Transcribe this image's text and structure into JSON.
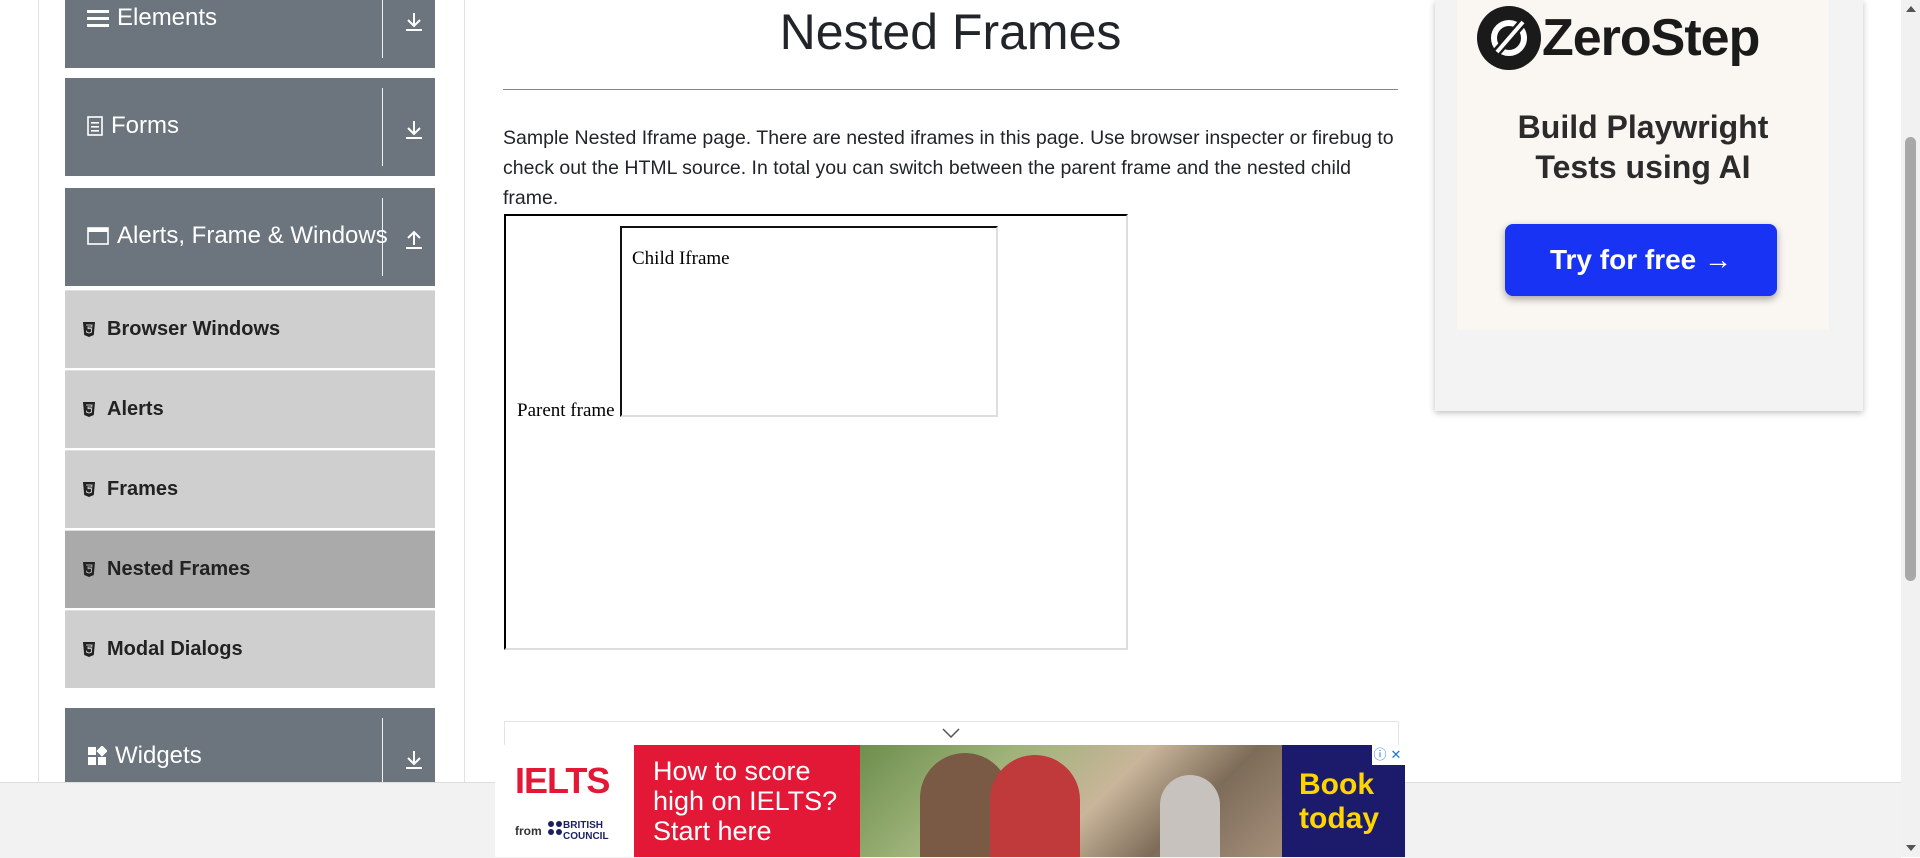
{
  "sidebar": {
    "groups": [
      {
        "label": "Elements",
        "icon": "menu-icon",
        "toggle": "download-icon"
      },
      {
        "label": "Forms",
        "icon": "document-icon",
        "toggle": "download-icon"
      },
      {
        "label": "Alerts, Frame & Windows",
        "icon": "window-icon",
        "toggle": "upload-icon"
      },
      {
        "label": "Widgets",
        "icon": "widgets-icon",
        "toggle": "download-icon"
      }
    ],
    "items": [
      {
        "label": "Browser Windows",
        "icon": "html5-icon"
      },
      {
        "label": "Alerts",
        "icon": "html5-icon"
      },
      {
        "label": "Frames",
        "icon": "html5-icon"
      },
      {
        "label": "Nested Frames",
        "icon": "html5-icon",
        "active": true
      },
      {
        "label": "Modal Dialogs",
        "icon": "html5-icon"
      }
    ]
  },
  "main": {
    "title": "Nested Frames",
    "description": "Sample Nested Iframe page. There are nested iframes in this page. Use browser inspecter or firebug to check out the HTML source. In total you can switch between the parent frame and the nested child frame.",
    "parent_frame_text": "Parent frame",
    "child_frame_text": "Child Iframe"
  },
  "side_ad": {
    "brand": "ZeroStep",
    "headline_line1": "Build Playwright",
    "headline_line2": "Tests using AI",
    "cta": "Try for free →"
  },
  "bottom_ad": {
    "logo": "IELTS",
    "from": "from",
    "council_line1": "BRITISH",
    "council_line2": "COUNCIL",
    "line1": "How to score",
    "line2": "high on IELTS?",
    "line3": "Start here",
    "cta_line1": "Book",
    "cta_line2": "today",
    "info": "ⓘ",
    "close": "✕"
  },
  "colors": {
    "group_header_bg": "#6c757d",
    "menu_item_bg": "#cfcfcf",
    "menu_item_active_bg": "#aaaaaa",
    "cta_blue": "#1933f5",
    "ielts_red": "#e31837",
    "book_navy": "#1c1a6b",
    "book_yellow": "#ffd500"
  }
}
